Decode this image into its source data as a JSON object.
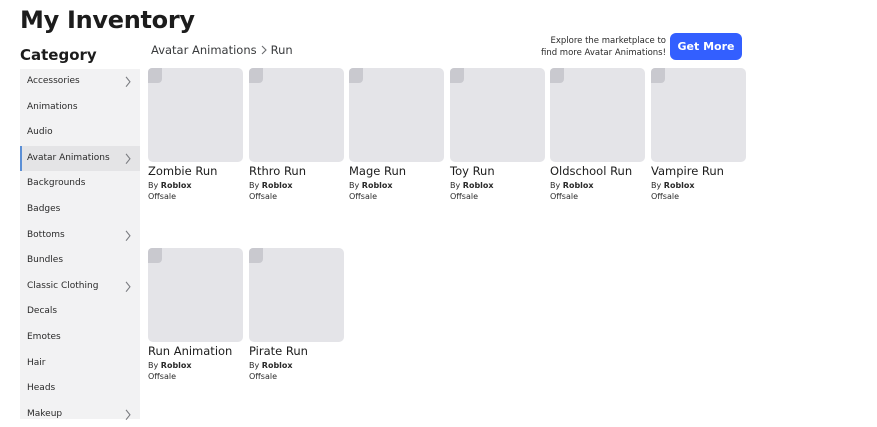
{
  "page_title": "My Inventory",
  "category_heading": "Category",
  "sidebar": {
    "items": [
      {
        "label": "Accessories",
        "has_arrow": true,
        "active": false
      },
      {
        "label": "Animations",
        "has_arrow": false,
        "active": false
      },
      {
        "label": "Audio",
        "has_arrow": false,
        "active": false
      },
      {
        "label": "Avatar Animations",
        "has_arrow": true,
        "active": true
      },
      {
        "label": "Backgrounds",
        "has_arrow": false,
        "active": false
      },
      {
        "label": "Badges",
        "has_arrow": false,
        "active": false
      },
      {
        "label": "Bottoms",
        "has_arrow": true,
        "active": false
      },
      {
        "label": "Bundles",
        "has_arrow": false,
        "active": false
      },
      {
        "label": "Classic Clothing",
        "has_arrow": true,
        "active": false
      },
      {
        "label": "Decals",
        "has_arrow": false,
        "active": false
      },
      {
        "label": "Emotes",
        "has_arrow": false,
        "active": false
      },
      {
        "label": "Hair",
        "has_arrow": false,
        "active": false
      },
      {
        "label": "Heads",
        "has_arrow": false,
        "active": false
      },
      {
        "label": "Makeup",
        "has_arrow": true,
        "active": false
      }
    ]
  },
  "breadcrumb": {
    "parent": "Avatar Animations",
    "current": "Run"
  },
  "promo": {
    "line1": "Explore the marketplace to",
    "line2": "find more Avatar Animations!",
    "button_label": "Get More"
  },
  "items": [
    {
      "name": "Zombie Run",
      "by_prefix": "By",
      "creator": "Roblox",
      "price": "Offsale"
    },
    {
      "name": "Rthro Run",
      "by_prefix": "By",
      "creator": "Roblox",
      "price": "Offsale"
    },
    {
      "name": "Mage Run",
      "by_prefix": "By",
      "creator": "Roblox",
      "price": "Offsale"
    },
    {
      "name": "Toy Run",
      "by_prefix": "By",
      "creator": "Roblox",
      "price": "Offsale"
    },
    {
      "name": "Oldschool Run",
      "by_prefix": "By",
      "creator": "Roblox",
      "price": "Offsale"
    },
    {
      "name": "Vampire Run",
      "by_prefix": "By",
      "creator": "Roblox",
      "price": "Offsale"
    },
    {
      "name": "Run Animation",
      "by_prefix": "By",
      "creator": "Roblox",
      "price": "Offsale"
    },
    {
      "name": "Pirate Run",
      "by_prefix": "By",
      "creator": "Roblox",
      "price": "Offsale"
    }
  ],
  "colors": {
    "accent": "#335fff",
    "active_marker": "#5b8fd6",
    "sidebar_bg": "#f2f2f3",
    "thumb_bg": "#e4e4e8"
  }
}
